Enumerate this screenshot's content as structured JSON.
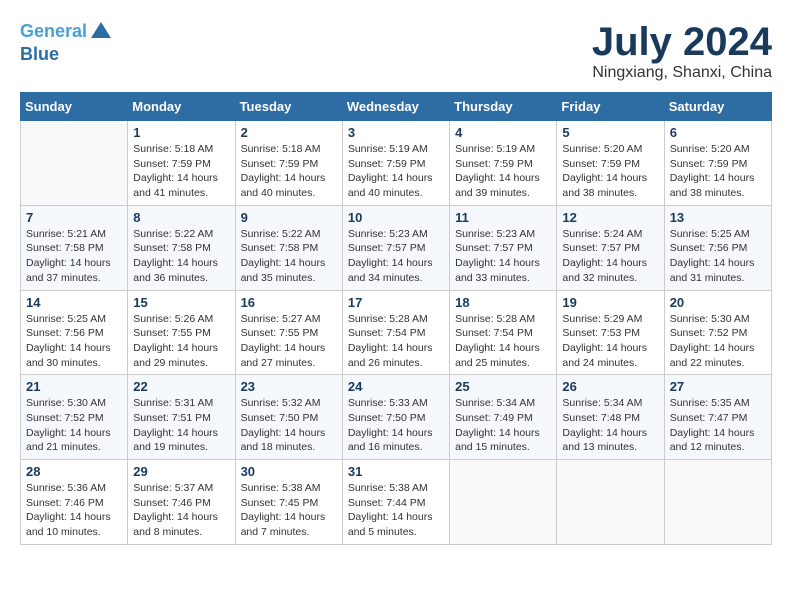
{
  "header": {
    "logo_line1": "General",
    "logo_line2": "Blue",
    "month": "July 2024",
    "location": "Ningxiang, Shanxi, China"
  },
  "days_of_week": [
    "Sunday",
    "Monday",
    "Tuesday",
    "Wednesday",
    "Thursday",
    "Friday",
    "Saturday"
  ],
  "weeks": [
    [
      {
        "day": "",
        "info": ""
      },
      {
        "day": "1",
        "info": "Sunrise: 5:18 AM\nSunset: 7:59 PM\nDaylight: 14 hours\nand 41 minutes."
      },
      {
        "day": "2",
        "info": "Sunrise: 5:18 AM\nSunset: 7:59 PM\nDaylight: 14 hours\nand 40 minutes."
      },
      {
        "day": "3",
        "info": "Sunrise: 5:19 AM\nSunset: 7:59 PM\nDaylight: 14 hours\nand 40 minutes."
      },
      {
        "day": "4",
        "info": "Sunrise: 5:19 AM\nSunset: 7:59 PM\nDaylight: 14 hours\nand 39 minutes."
      },
      {
        "day": "5",
        "info": "Sunrise: 5:20 AM\nSunset: 7:59 PM\nDaylight: 14 hours\nand 38 minutes."
      },
      {
        "day": "6",
        "info": "Sunrise: 5:20 AM\nSunset: 7:59 PM\nDaylight: 14 hours\nand 38 minutes."
      }
    ],
    [
      {
        "day": "7",
        "info": "Sunrise: 5:21 AM\nSunset: 7:58 PM\nDaylight: 14 hours\nand 37 minutes."
      },
      {
        "day": "8",
        "info": "Sunrise: 5:22 AM\nSunset: 7:58 PM\nDaylight: 14 hours\nand 36 minutes."
      },
      {
        "day": "9",
        "info": "Sunrise: 5:22 AM\nSunset: 7:58 PM\nDaylight: 14 hours\nand 35 minutes."
      },
      {
        "day": "10",
        "info": "Sunrise: 5:23 AM\nSunset: 7:57 PM\nDaylight: 14 hours\nand 34 minutes."
      },
      {
        "day": "11",
        "info": "Sunrise: 5:23 AM\nSunset: 7:57 PM\nDaylight: 14 hours\nand 33 minutes."
      },
      {
        "day": "12",
        "info": "Sunrise: 5:24 AM\nSunset: 7:57 PM\nDaylight: 14 hours\nand 32 minutes."
      },
      {
        "day": "13",
        "info": "Sunrise: 5:25 AM\nSunset: 7:56 PM\nDaylight: 14 hours\nand 31 minutes."
      }
    ],
    [
      {
        "day": "14",
        "info": "Sunrise: 5:25 AM\nSunset: 7:56 PM\nDaylight: 14 hours\nand 30 minutes."
      },
      {
        "day": "15",
        "info": "Sunrise: 5:26 AM\nSunset: 7:55 PM\nDaylight: 14 hours\nand 29 minutes."
      },
      {
        "day": "16",
        "info": "Sunrise: 5:27 AM\nSunset: 7:55 PM\nDaylight: 14 hours\nand 27 minutes."
      },
      {
        "day": "17",
        "info": "Sunrise: 5:28 AM\nSunset: 7:54 PM\nDaylight: 14 hours\nand 26 minutes."
      },
      {
        "day": "18",
        "info": "Sunrise: 5:28 AM\nSunset: 7:54 PM\nDaylight: 14 hours\nand 25 minutes."
      },
      {
        "day": "19",
        "info": "Sunrise: 5:29 AM\nSunset: 7:53 PM\nDaylight: 14 hours\nand 24 minutes."
      },
      {
        "day": "20",
        "info": "Sunrise: 5:30 AM\nSunset: 7:52 PM\nDaylight: 14 hours\nand 22 minutes."
      }
    ],
    [
      {
        "day": "21",
        "info": "Sunrise: 5:30 AM\nSunset: 7:52 PM\nDaylight: 14 hours\nand 21 minutes."
      },
      {
        "day": "22",
        "info": "Sunrise: 5:31 AM\nSunset: 7:51 PM\nDaylight: 14 hours\nand 19 minutes."
      },
      {
        "day": "23",
        "info": "Sunrise: 5:32 AM\nSunset: 7:50 PM\nDaylight: 14 hours\nand 18 minutes."
      },
      {
        "day": "24",
        "info": "Sunrise: 5:33 AM\nSunset: 7:50 PM\nDaylight: 14 hours\nand 16 minutes."
      },
      {
        "day": "25",
        "info": "Sunrise: 5:34 AM\nSunset: 7:49 PM\nDaylight: 14 hours\nand 15 minutes."
      },
      {
        "day": "26",
        "info": "Sunrise: 5:34 AM\nSunset: 7:48 PM\nDaylight: 14 hours\nand 13 minutes."
      },
      {
        "day": "27",
        "info": "Sunrise: 5:35 AM\nSunset: 7:47 PM\nDaylight: 14 hours\nand 12 minutes."
      }
    ],
    [
      {
        "day": "28",
        "info": "Sunrise: 5:36 AM\nSunset: 7:46 PM\nDaylight: 14 hours\nand 10 minutes."
      },
      {
        "day": "29",
        "info": "Sunrise: 5:37 AM\nSunset: 7:46 PM\nDaylight: 14 hours\nand 8 minutes."
      },
      {
        "day": "30",
        "info": "Sunrise: 5:38 AM\nSunset: 7:45 PM\nDaylight: 14 hours\nand 7 minutes."
      },
      {
        "day": "31",
        "info": "Sunrise: 5:38 AM\nSunset: 7:44 PM\nDaylight: 14 hours\nand 5 minutes."
      },
      {
        "day": "",
        "info": ""
      },
      {
        "day": "",
        "info": ""
      },
      {
        "day": "",
        "info": ""
      }
    ]
  ]
}
